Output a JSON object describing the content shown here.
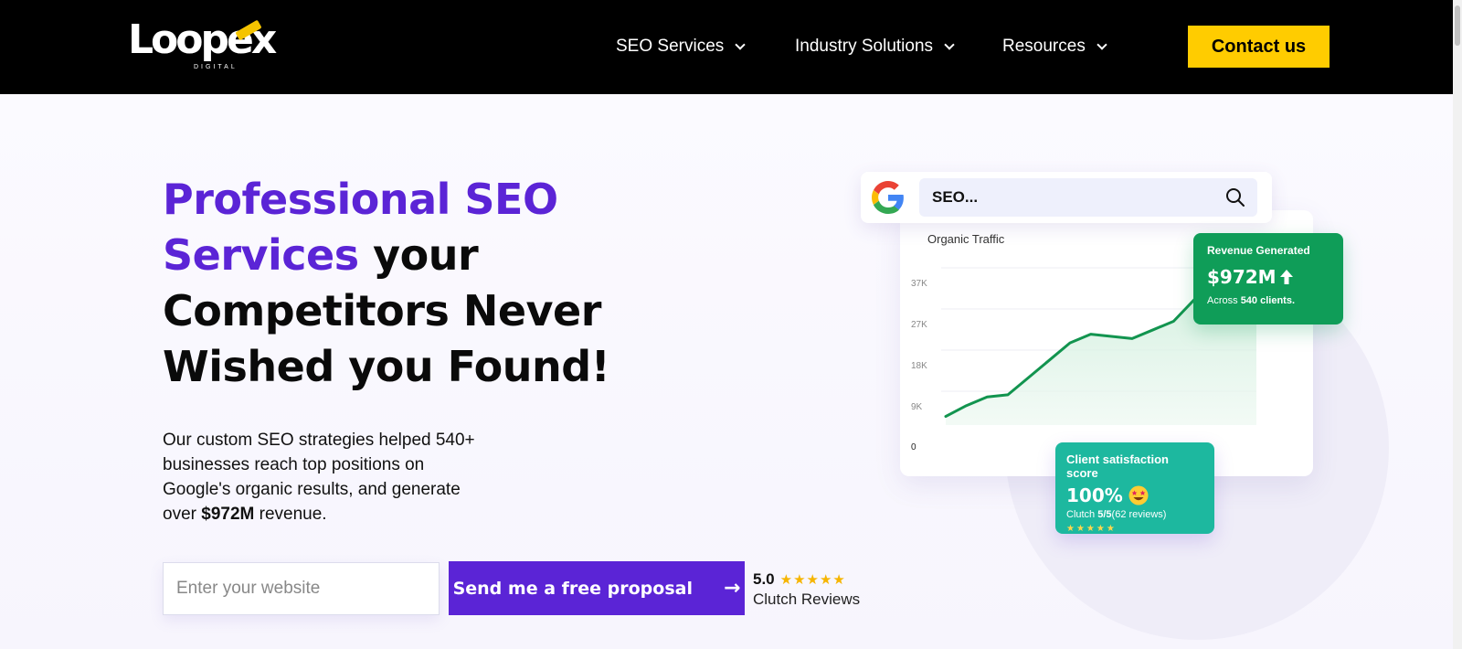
{
  "header": {
    "logo_text": "Loopex",
    "logo_sub": "DIGITAL",
    "nav": [
      {
        "label": "SEO Services"
      },
      {
        "label": "Industry Solutions"
      },
      {
        "label": "Resources"
      }
    ],
    "contact_label": "Contact us"
  },
  "hero": {
    "headline_purple": "Professional SEO Services",
    "headline_rest": " your Competitors Never Wished you Found!",
    "desc_before": "Our custom SEO strategies helped 540+ businesses reach top positions on Google's organic results, and generate over ",
    "desc_bold": "$972M",
    "desc_after": " revenue.",
    "input_placeholder": "Enter your website",
    "cta_label": "Send me a free proposal",
    "clutch_score": "5.0",
    "clutch_label": "Clutch Reviews"
  },
  "search": {
    "query": "SEO..."
  },
  "chart_data": {
    "type": "area",
    "title": "Organic Traffic",
    "y_ticks": [
      "37K",
      "27K",
      "18K",
      "9K",
      "0"
    ],
    "x": [
      0,
      1,
      2,
      3,
      4,
      5,
      6,
      7,
      8,
      9,
      10,
      11,
      12,
      13,
      14,
      15
    ],
    "values": [
      2000,
      4500,
      6500,
      7000,
      11000,
      15000,
      19000,
      21000,
      20500,
      20000,
      22000,
      24000,
      29000,
      34000,
      33500,
      34000
    ],
    "ylim": [
      0,
      37000
    ],
    "line_color": "#12944f",
    "grid": true
  },
  "revenue_card": {
    "title": "Revenue Generated",
    "value": "$972M",
    "sub_before": "Across ",
    "sub_bold": "540 clients.",
    "color": "#0f9d58"
  },
  "satisfaction_card": {
    "title": "Client satisfaction score",
    "value": "100%",
    "sub_before": "Clutch ",
    "sub_bold": "5/5",
    "sub_after": "(62 reviews)",
    "color": "#1db89f"
  },
  "colors": {
    "brand_purple": "#5b24d6",
    "cta_yellow": "#ffcc00"
  }
}
